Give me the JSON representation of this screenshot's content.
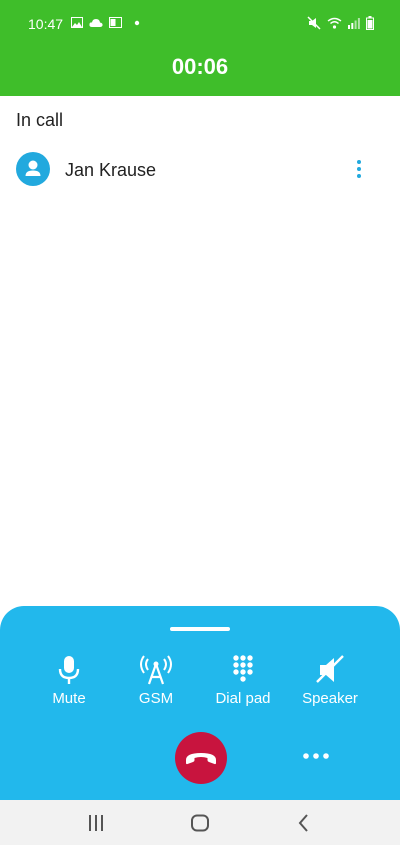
{
  "status_bar": {
    "time": "10:47"
  },
  "call": {
    "timer": "00:06",
    "state": "In call"
  },
  "participant": {
    "name": "Jan Krause"
  },
  "controls": {
    "mute": "Mute",
    "gsm": "GSM",
    "dial_pad": "Dial pad",
    "speaker": "Speaker"
  },
  "colors": {
    "header": "#3fbe2a",
    "panel": "#22b8ec",
    "end_call": "#c8143e",
    "accent": "#22a9de"
  },
  "icons": [
    "gallery-icon",
    "cloud-icon",
    "outlook-icon",
    "notification-dot-icon",
    "mute-status-icon",
    "wifi-icon",
    "signal-icon",
    "battery-icon",
    "person-icon",
    "more-vert-icon",
    "microphone-icon",
    "antenna-icon",
    "dialpad-icon",
    "speaker-off-icon",
    "end-call-icon",
    "more-horiz-icon",
    "recents-icon",
    "home-icon",
    "back-icon"
  ]
}
